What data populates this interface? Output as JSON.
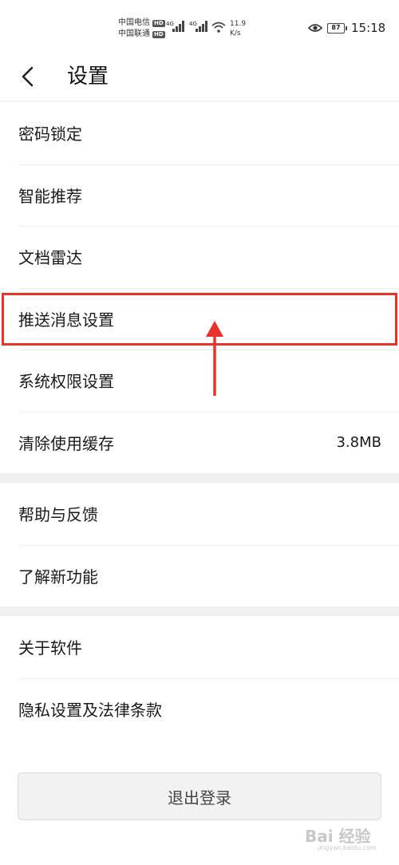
{
  "status_bar": {
    "carrier1": "中国电信",
    "carrier2": "中国联通",
    "hd": "HD",
    "net1": "4G",
    "net2": "4G",
    "speed_value": "11.9",
    "speed_unit": "K/s",
    "battery": "87",
    "time": "15:18"
  },
  "header": {
    "title": "设置"
  },
  "sections": [
    {
      "items": [
        {
          "label": "密码锁定"
        },
        {
          "label": "智能推荐"
        },
        {
          "label": "文档雷达"
        },
        {
          "label": "推送消息设置"
        },
        {
          "label": "系统权限设置"
        },
        {
          "label": "清除使用缓存",
          "value": "3.8MB"
        }
      ]
    },
    {
      "items": [
        {
          "label": "帮助与反馈"
        },
        {
          "label": "了解新功能"
        }
      ]
    },
    {
      "items": [
        {
          "label": "关于软件"
        },
        {
          "label": "隐私设置及法律条款"
        }
      ]
    }
  ],
  "logout_label": "退出登录",
  "watermark": {
    "text": "Bai 经验",
    "sub": "jingyan.baidu.com"
  },
  "colors": {
    "highlight": "#e8332b",
    "divider": "#f0f0f0"
  }
}
